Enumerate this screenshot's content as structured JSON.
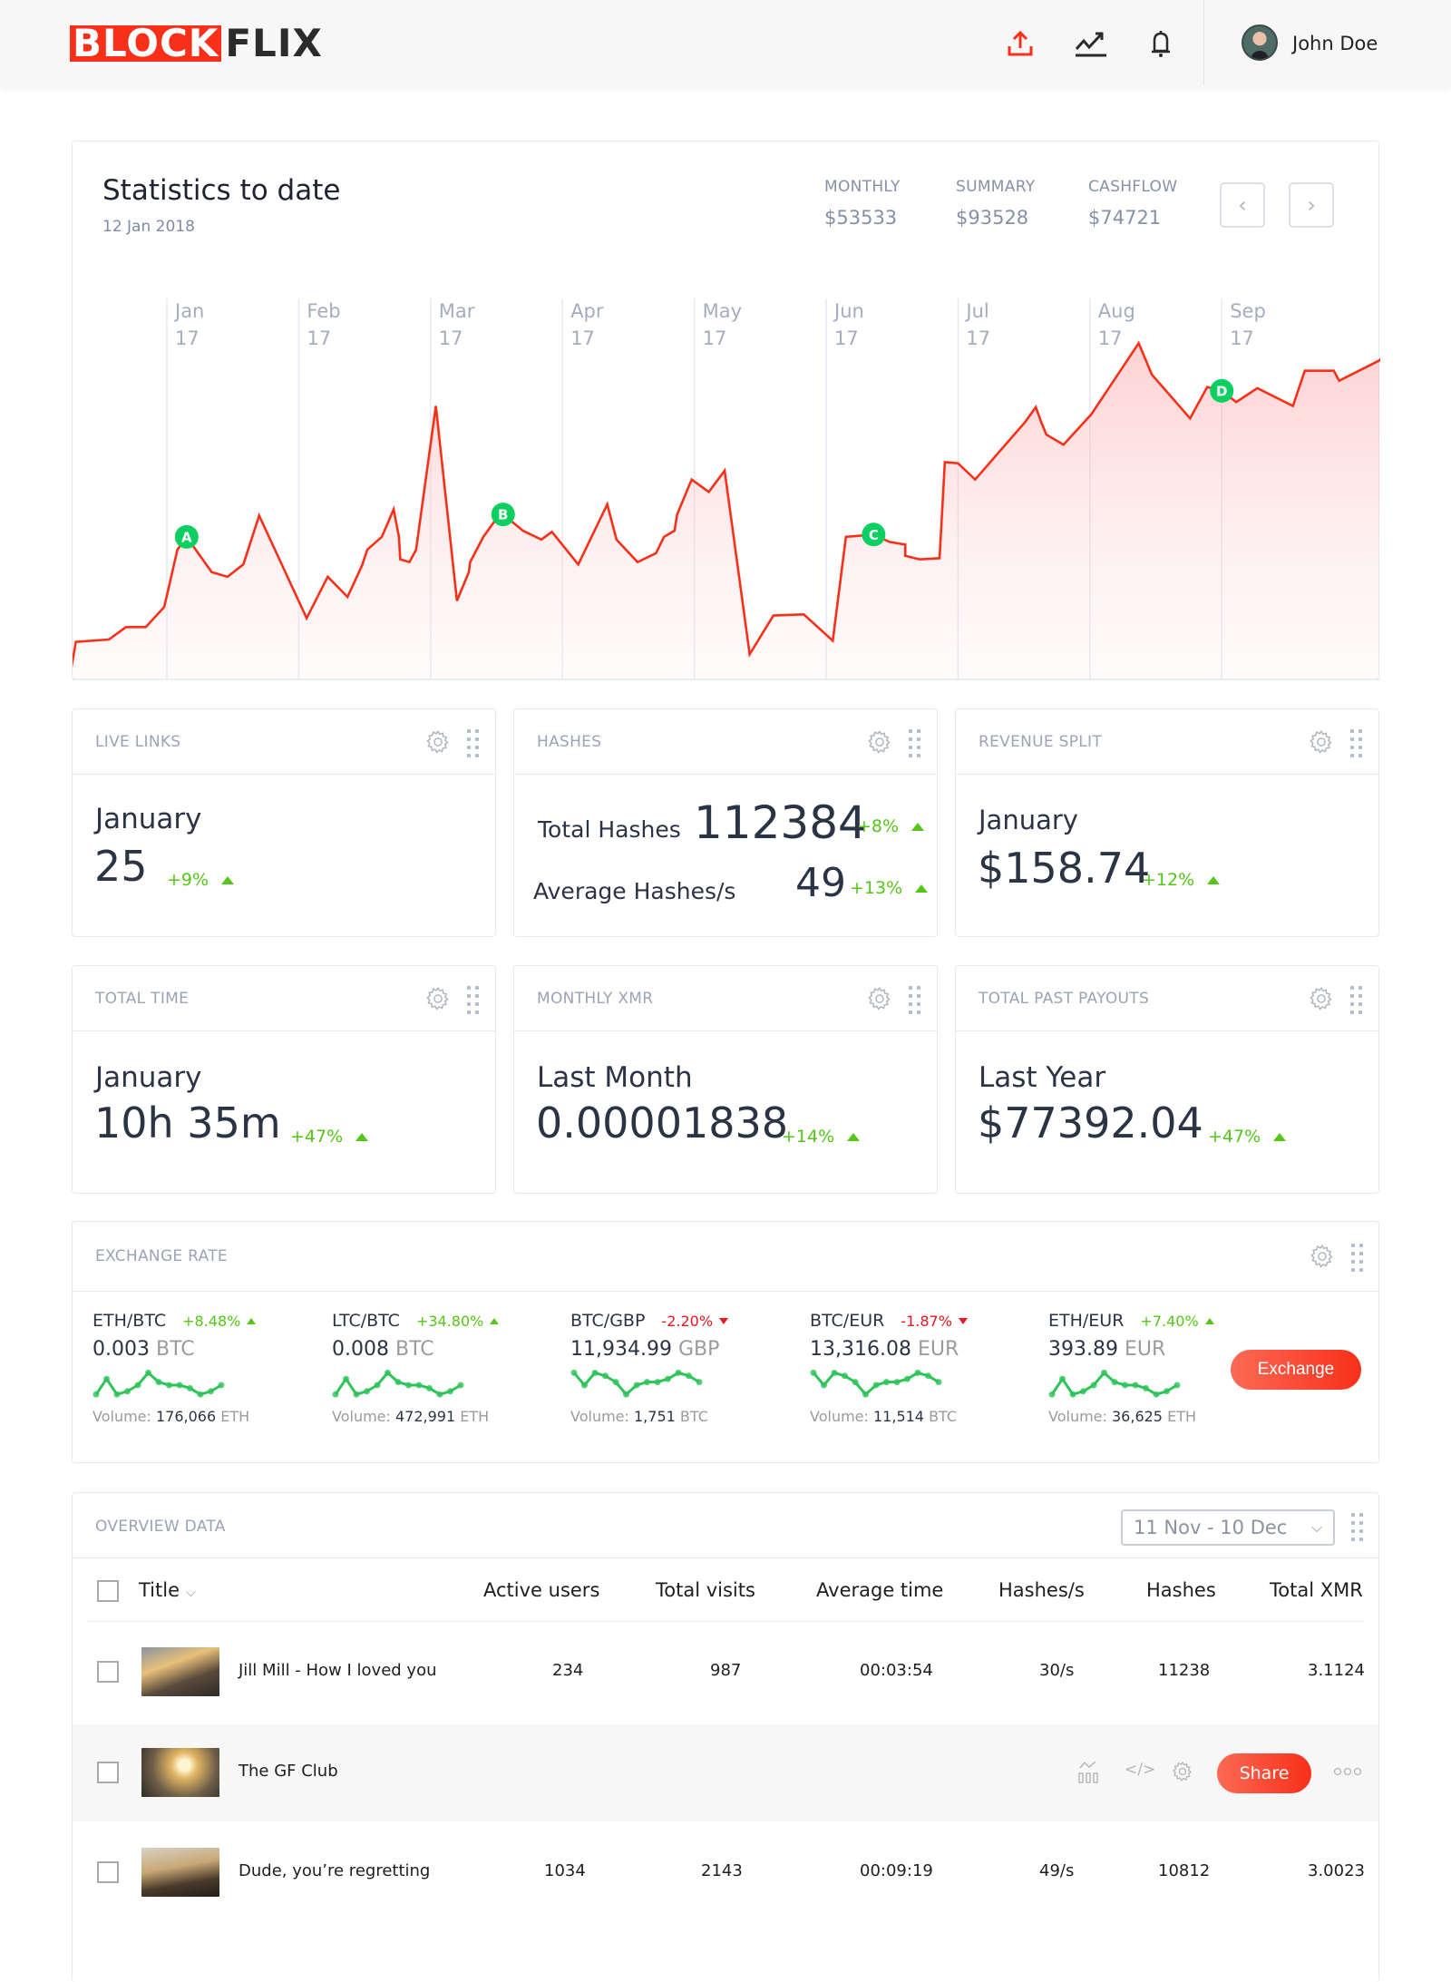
{
  "brand": {
    "logo_part1": "BLOCK",
    "logo_part2": "FLIX",
    "accent": "#f8301a",
    "positive": "#55c51a",
    "negative": "#e8161b",
    "spark": "#2ec45a",
    "marker": "#0ccf62"
  },
  "topbar": {
    "icons": [
      "upload-icon",
      "trending-up-icon",
      "bell-icon"
    ],
    "user_name": "John Doe"
  },
  "stats_chart": {
    "title": "Statistics to date",
    "date": "12 Jan 2018",
    "metrics": [
      {
        "label": "MONTHLY",
        "value": "$53533"
      },
      {
        "label": "SUMMARY",
        "value": "$93528"
      },
      {
        "label": "CASHFLOW",
        "value": "$74721"
      }
    ],
    "prev_label": "‹",
    "next_label": "›"
  },
  "chart_data": {
    "type": "area",
    "title": "Statistics to date",
    "xlabel": "",
    "ylabel": "",
    "categories": [
      {
        "month": "Jan",
        "year": "17"
      },
      {
        "month": "Feb",
        "year": "17"
      },
      {
        "month": "Mar",
        "year": "17"
      },
      {
        "month": "Apr",
        "year": "17"
      },
      {
        "month": "May",
        "year": "17"
      },
      {
        "month": "Jun",
        "year": "17"
      },
      {
        "month": "Jul",
        "year": "17"
      },
      {
        "month": "Aug",
        "year": "17"
      },
      {
        "month": "Sep",
        "year": "17"
      }
    ],
    "x_range": [
      -0.74,
      9.4
    ],
    "ylim": [
      0,
      100
    ],
    "grid": "vertical",
    "series": [
      {
        "name": "statistics",
        "points": [
          [
            -0.74,
            0
          ],
          [
            -0.69,
            9.7
          ],
          [
            -0.44,
            10.3
          ],
          [
            -0.31,
            13.5
          ],
          [
            -0.16,
            13.5
          ],
          [
            -0.02,
            18.7
          ],
          [
            0.08,
            33.5
          ],
          [
            0.15,
            36.8
          ],
          [
            0.34,
            27.7
          ],
          [
            0.46,
            26.5
          ],
          [
            0.58,
            29.7
          ],
          [
            0.7,
            42.3
          ],
          [
            1.06,
            15.8
          ],
          [
            1.22,
            26.5
          ],
          [
            1.37,
            21.3
          ],
          [
            1.48,
            29.4
          ],
          [
            1.52,
            33.5
          ],
          [
            1.63,
            36.8
          ],
          [
            1.72,
            43.9
          ],
          [
            1.76,
            36.8
          ],
          [
            1.77,
            31.0
          ],
          [
            1.84,
            30.3
          ],
          [
            1.89,
            33.5
          ],
          [
            2.04,
            70.6
          ],
          [
            2.2,
            20.3
          ],
          [
            2.29,
            27.7
          ],
          [
            2.3,
            30.3
          ],
          [
            2.4,
            36.8
          ],
          [
            2.48,
            40.6
          ],
          [
            2.55,
            42.6
          ],
          [
            2.7,
            38.4
          ],
          [
            2.84,
            36.1
          ],
          [
            2.92,
            38.1
          ],
          [
            3.12,
            29.7
          ],
          [
            3.34,
            45.2
          ],
          [
            3.41,
            36.1
          ],
          [
            3.57,
            30.3
          ],
          [
            3.71,
            32.6
          ],
          [
            3.77,
            36.8
          ],
          [
            3.85,
            38.4
          ],
          [
            3.87,
            42.6
          ],
          [
            3.98,
            51.6
          ],
          [
            4.11,
            48.4
          ],
          [
            4.23,
            53.9
          ],
          [
            4.42,
            6.5
          ],
          [
            4.6,
            16.5
          ],
          [
            4.83,
            16.8
          ],
          [
            5.05,
            10.0
          ],
          [
            5.15,
            36.8
          ],
          [
            5.36,
            37.4
          ],
          [
            5.48,
            35.5
          ],
          [
            5.6,
            34.8
          ],
          [
            5.6,
            31.9
          ],
          [
            5.71,
            31.0
          ],
          [
            5.86,
            31.3
          ],
          [
            5.9,
            56.1
          ],
          [
            6.0,
            55.8
          ],
          [
            6.13,
            51.6
          ],
          [
            6.51,
            66.5
          ],
          [
            6.59,
            70.3
          ],
          [
            6.63,
            66.5
          ],
          [
            6.67,
            63.2
          ],
          [
            6.8,
            60.6
          ],
          [
            7.01,
            68.4
          ],
          [
            7.37,
            86.8
          ],
          [
            7.47,
            78.7
          ],
          [
            7.76,
            67.4
          ],
          [
            7.89,
            75.5
          ],
          [
            8.0,
            74.5
          ],
          [
            8.11,
            71.6
          ],
          [
            8.27,
            75.2
          ],
          [
            8.54,
            70.6
          ],
          [
            8.63,
            79.7
          ],
          [
            8.85,
            79.7
          ],
          [
            8.89,
            77.1
          ],
          [
            9.21,
            82.6
          ]
        ]
      }
    ],
    "annotations": [
      {
        "label": "A",
        "x": 0.15,
        "y": 36.8
      },
      {
        "label": "B",
        "x": 2.55,
        "y": 42.6
      },
      {
        "label": "C",
        "x": 5.36,
        "y": 37.4
      },
      {
        "label": "D",
        "x": 8.0,
        "y": 74.5
      }
    ]
  },
  "stat_cards": [
    {
      "title": "LIVE LINKS",
      "sub": "January",
      "value": "25",
      "delta": "+9%"
    },
    {
      "title": "HASHES",
      "rows": [
        {
          "label": "Total Hashes",
          "value": "112384",
          "delta": "+8%"
        },
        {
          "label": "Average Hashes/s",
          "value": "49",
          "delta": "+13%"
        }
      ]
    },
    {
      "title": "REVENUE SPLIT",
      "sub": "January",
      "value": "$158.74",
      "delta": "+12%"
    },
    {
      "title": "TOTAL TIME",
      "sub": "January",
      "value": "10h 35m",
      "delta": "+47%"
    },
    {
      "title": "MONTHLY XMR",
      "sub": "Last Month",
      "value": "0.00001838",
      "delta": "+14%"
    },
    {
      "title": "TOTAL PAST PAYOUTS",
      "sub": "Last Year",
      "value": "$77392.04",
      "delta": "+47%"
    }
  ],
  "exchange": {
    "title": "EXCHANGE RATE",
    "button_label": "Exchange",
    "volume_label": "Volume:",
    "pairs": [
      {
        "pair": "ETH/BTC",
        "change": "+8.48%",
        "direction": "up",
        "price": "0.003",
        "unit": "BTC",
        "volume": "176,066",
        "volume_unit": "ETH",
        "spark": [
          2,
          7,
          2,
          3,
          5,
          9,
          6,
          5,
          5,
          4,
          2,
          3,
          5
        ]
      },
      {
        "pair": "LTC/BTC",
        "change": "+34.80%",
        "direction": "up",
        "price": "0.008",
        "unit": "BTC",
        "volume": "472,991",
        "volume_unit": "ETH",
        "spark": [
          2,
          7,
          2,
          3,
          5,
          9,
          6,
          5,
          5,
          4,
          2,
          3,
          5
        ]
      },
      {
        "pair": "BTC/GBP",
        "change": "-2.20%",
        "direction": "down",
        "price": "11,934.99",
        "unit": "GBP",
        "volume": "1,751",
        "volume_unit": "BTC",
        "spark": [
          9,
          5,
          9,
          8,
          6,
          2,
          5,
          6,
          6,
          7,
          9,
          8,
          6
        ]
      },
      {
        "pair": "BTC/EUR",
        "change": "-1.87%",
        "direction": "down",
        "price": "13,316.08",
        "unit": "EUR",
        "volume": "11,514",
        "volume_unit": "BTC",
        "spark": [
          9,
          5,
          9,
          8,
          6,
          2,
          5,
          6,
          6,
          7,
          9,
          8,
          6
        ]
      },
      {
        "pair": "ETH/EUR",
        "change": "+7.40%",
        "direction": "up",
        "price": "393.89",
        "unit": "EUR",
        "volume": "36,625",
        "volume_unit": "ETH",
        "spark": [
          2,
          7,
          2,
          3,
          5,
          9,
          6,
          5,
          5,
          4,
          2,
          3,
          5
        ]
      }
    ]
  },
  "overview": {
    "title": "OVERVIEW DATA",
    "date_range": "11 Nov - 10 Dec",
    "columns": [
      "Title",
      "Active users",
      "Total visits",
      "Average time",
      "Hashes/s",
      "Hashes",
      "Total XMR"
    ],
    "rows": [
      {
        "title": "Jill Mill - How I loved you",
        "active_users": "234",
        "total_visits": "987",
        "average_time": "00:03:54",
        "hashes_per_s": "30/s",
        "hashes": "11238",
        "total_xmr": "3.1124",
        "hovered": false
      },
      {
        "title": "The GF Club",
        "hovered": true,
        "share_label": "Share"
      },
      {
        "title": "Dude, you’re regretting",
        "active_users": "1034",
        "total_visits": "2143",
        "average_time": "00:09:19",
        "hashes_per_s": "49/s",
        "hashes": "10812",
        "total_xmr": "3.0023",
        "hovered": false
      }
    ]
  }
}
